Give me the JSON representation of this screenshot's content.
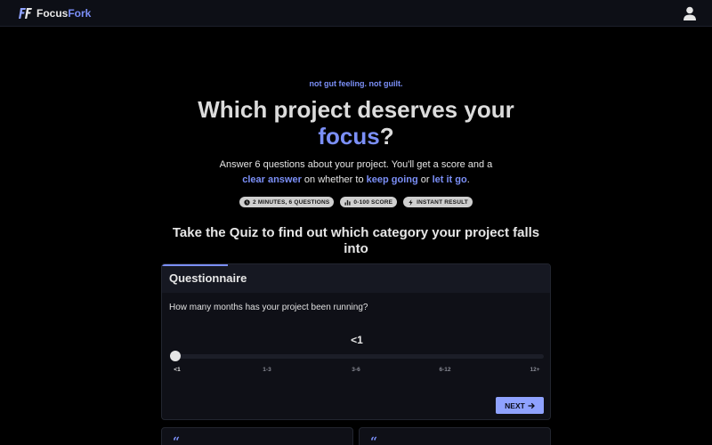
{
  "header": {
    "brand_part1": "Focus",
    "brand_part2": "Fork",
    "logo_icon": "ff-logo-icon",
    "user_icon": "user-icon"
  },
  "hero": {
    "tagline": "not gut feeling. not guilt.",
    "title_line1": "Which project deserves your",
    "title_accent": "focus",
    "title_end": "?",
    "desc_line1": "Answer 6 questions about your project. You'll get a score and a",
    "desc_hl1": "clear answer",
    "desc_mid1": " on whether to ",
    "desc_hl2": "keep going",
    "desc_mid2": " or ",
    "desc_hl3": "let it go",
    "desc_end": "."
  },
  "badges": [
    {
      "label": "2 MINUTES, 6 QUESTIONS",
      "icon": "clock-icon"
    },
    {
      "label": "0-100 SCORE",
      "icon": "bar-chart-icon"
    },
    {
      "label": "INSTANT RESULT",
      "icon": "lightning-icon"
    }
  ],
  "quiz_heading": {
    "line1": "Take the Quiz to find out which category your project falls",
    "line2": "into"
  },
  "questionnaire": {
    "title": "Questionnaire",
    "question": "How many months has your project been running?",
    "current_value": "<1",
    "slider_level": 0,
    "options": [
      "<1",
      "1-3",
      "3-6",
      "6-12",
      "12+"
    ],
    "next_label": "NEXT"
  },
  "colors": {
    "accent": "#7b8ff7",
    "button": "#8fa2ff",
    "background": "#000000",
    "card": "#0f1017"
  }
}
